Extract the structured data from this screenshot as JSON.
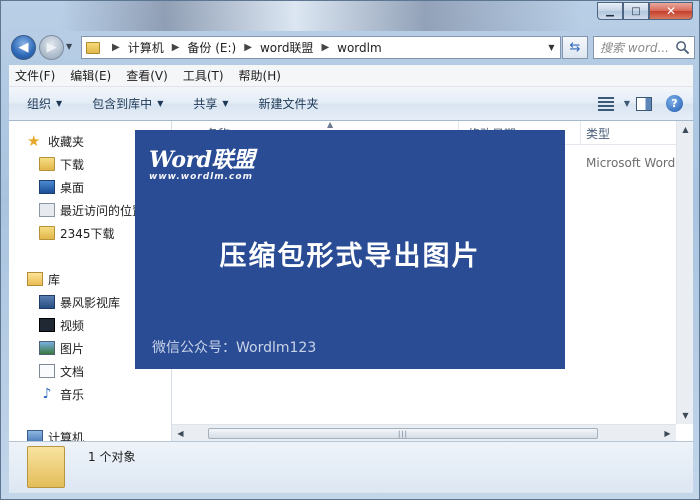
{
  "window": {
    "caption_buttons": [
      "minimize",
      "maximize",
      "close"
    ]
  },
  "nav": {
    "path": [
      "计算机",
      "备份 (E:)",
      "word联盟",
      "wordlm"
    ],
    "search_placeholder": "搜索 word..."
  },
  "menu": [
    "文件(F)",
    "编辑(E)",
    "查看(V)",
    "工具(T)",
    "帮助(H)"
  ],
  "commands": {
    "organize": "组织",
    "include_library": "包含到库中",
    "share": "共享",
    "new_folder": "新建文件夹"
  },
  "sidebar": {
    "favorites": {
      "label": "收藏夹",
      "items": [
        "下载",
        "桌面",
        "最近访问的位置",
        "2345下载"
      ]
    },
    "libraries": {
      "label": "库",
      "items": [
        "暴风影视库",
        "视频",
        "图片",
        "文档",
        "音乐"
      ]
    },
    "computer": {
      "label": "计算机"
    }
  },
  "file_list": {
    "columns": [
      "名称",
      "修改日期",
      "类型"
    ],
    "rows": [
      {
        "type": "Microsoft Word ..."
      }
    ]
  },
  "status": {
    "text": "1 个对象"
  },
  "overlay": {
    "brand_name": "Word联盟",
    "brand_url": "www.wordlm.com",
    "title": "压缩包形式导出图片",
    "footer": "微信公众号：Wordlm123",
    "background_color": "#2a4c94"
  }
}
